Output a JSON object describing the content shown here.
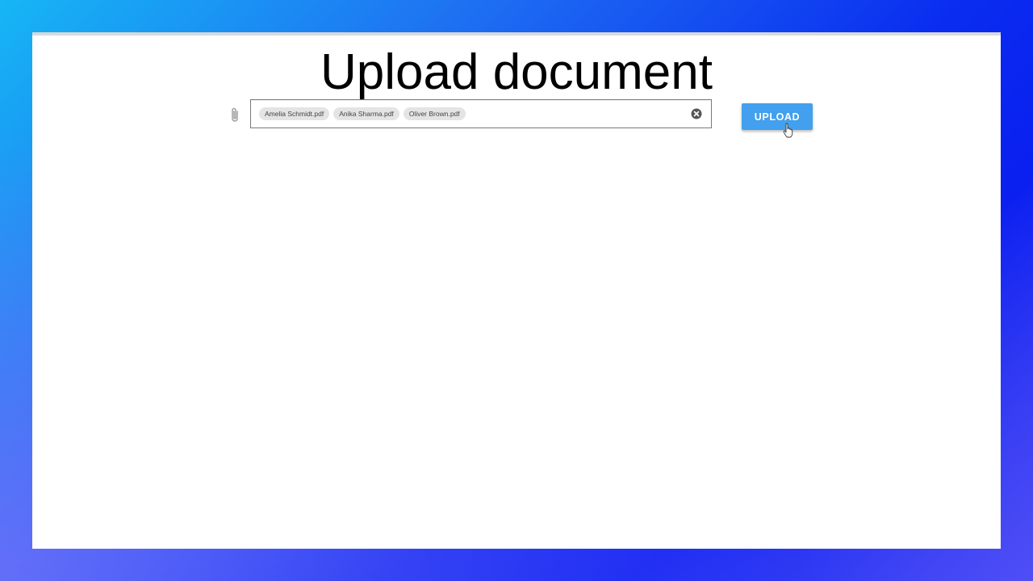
{
  "page": {
    "title": "Upload document"
  },
  "file_field": {
    "files": [
      {
        "label": "Amelia Schmidt.pdf"
      },
      {
        "label": "Anika Sharma.pdf"
      },
      {
        "label": "Oliver Brown.pdf"
      }
    ],
    "attach_icon": "paperclip-icon",
    "clear_icon": "clear-circle-icon"
  },
  "actions": {
    "upload_label": "UPLOAD"
  },
  "colors": {
    "accent": "#42a0ee",
    "chip_background": "#e4e4e4",
    "field_border": "#7a7a7a"
  },
  "pointer": {
    "icon": "hand-pointer-icon"
  }
}
